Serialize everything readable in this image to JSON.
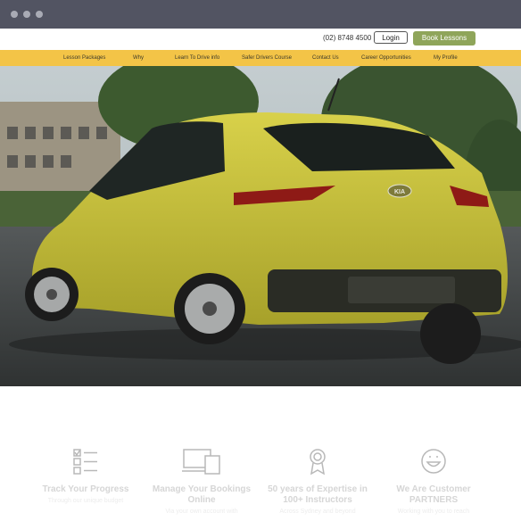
{
  "topbar": {
    "phone": "(02) 8748 4500",
    "login_label": "Login",
    "book_label": "Book Lessons"
  },
  "nav": {
    "items": [
      {
        "label": "Lesson Packages"
      },
      {
        "label": "Why"
      },
      {
        "label": "Learn To Drive info"
      },
      {
        "label": "Safer Drivers Course"
      },
      {
        "label": "Contact Us"
      },
      {
        "label": "Career Opportunities"
      },
      {
        "label": "My Profile"
      }
    ]
  },
  "hero": {
    "car_badge": "KIA"
  },
  "features": [
    {
      "icon": "checklist-icon",
      "title": "Track Your Progress",
      "subtitle": "Through our unique budget"
    },
    {
      "icon": "devices-icon",
      "title": "Manage Your Bookings Online",
      "subtitle": "Via your own account with"
    },
    {
      "icon": "award-ribbon-icon",
      "title": "50 years of Expertise in 100+ Instructors",
      "subtitle": "Across Sydney and beyond"
    },
    {
      "icon": "smiley-icon",
      "title": "We Are Customer PARTNERS",
      "subtitle": "Working with you to reach"
    }
  ],
  "colors": {
    "nav_bar": "#f3c447",
    "book_button": "#8fa55a",
    "window_chrome": "#525462",
    "car_body": "#c9c33a"
  }
}
